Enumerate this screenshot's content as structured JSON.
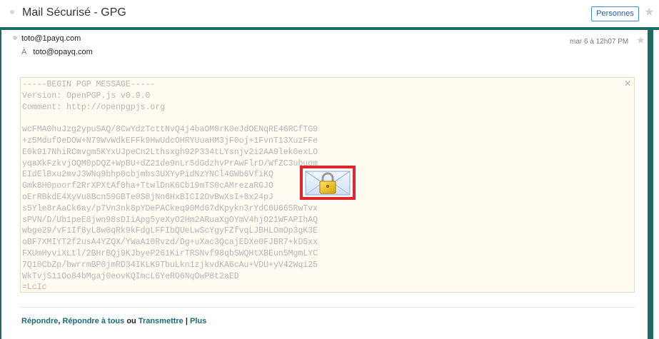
{
  "app": {
    "title": "Mail Sécurisé - GPG",
    "people_button": "Personnes"
  },
  "message": {
    "from": "toto@1payq.com",
    "to_label": "À",
    "to": "toto@opayq.com",
    "date": "mar 6 à 12h07 PM"
  },
  "pgp_text": "-----BEGIN PGP MESSAGE-----\nVersion: OpenPGP.js v0.9.0\nComment: http://openpgpjs.org\n\nwcFMA0huJzg2ypuSAQ/8CwYdzTcttNvQ4j4baOM0rK0eJdOENqRE46RCfTG9\n+z5MdufOeDOW+N79WvWdkEFFk9HwUdcOHRYUuaHM3jF0oj+1FvnT13XuzFFe\nE0k917NhiRCmvgm5KYxUJpeCn2Lthsxgh92P334tLYsnjv2i2AA9lek0exLO\nyqaXkFzkvjOQM0pDQZ+WpBU+dZ21de9nLr5dGdzhvPrAwFlrD/WfZC3ubuom\nEIdElBxu2mvJ3WNq9bhp0cbjmbs3UXYyPidNzYNCl4GWb6VfiKQ\nGmk8H0poorf2RrXPXtAf0ha+TtwlDnK6Cb19mTS0cAMrezaRGJO\noErRBkdE4XyVu8Bcn59GBTe0S8jNn6HxBICI2OvBwXsI+8x24pJ\ns5Yle8rAaCk6ay/p7Vn3nk8pYDePACkeq90Md67dKpykn3rYdC6U665RwTvx\nsPVN/D/Ub1peE8jwn98sDIiApg5yeXyO2Hm2ARuaXgOYmV4hjO21WFAPIhAQ\nwbge29/vF1If8yL8w0qRk9kFdgLFFIbQUeLwScYgyFZfvqLJBHLOmOp3gK3E\noBF7XMIYT2f2usA4YZQX/YWaA10Rvzd/Dg+uXac3QcajEDXe0FJBR7+kD5xx\nFXUmHyviXLtl/2BHrBQj9KJbyeP261KirTRSNvf98qbSWQHtXBEun5MgmLYC\n7Q10CbZp/bwrrmBP0jmRD34IKLK9TbuLkn1zjkvdKA6cAu+VDU+yV42Wqi25\nWkTvjS11Oo84bMgaj0eovKQImcL6YeRO6NqOwP8t2aED\n=LcIc\n-----END PGP MESSAGE-----",
  "actions": {
    "reply": "Répondre",
    "sep1": ", ",
    "reply_all": "Répondre à tous",
    "or": " ou ",
    "forward": "Transmettre",
    "bar": " | ",
    "more": "Plus"
  }
}
